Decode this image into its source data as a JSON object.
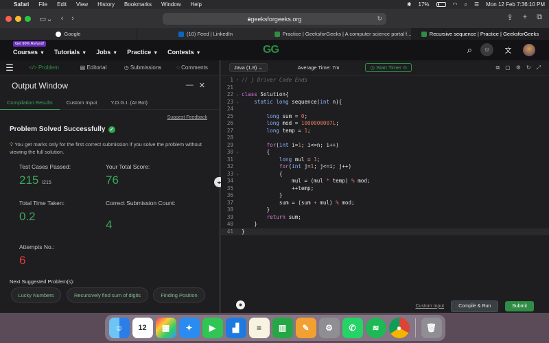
{
  "menubar": {
    "app": "Safari",
    "items": [
      "File",
      "Edit",
      "View",
      "History",
      "Bookmarks",
      "Window",
      "Help"
    ],
    "battery": "17%",
    "datetime": "Mon 12 Feb  7:36:10 PM"
  },
  "browser": {
    "url": "geeksforgeeks.org",
    "tabs": [
      {
        "label": "Google",
        "favicon_color": "#ffffff"
      },
      {
        "label": "(10) Feed | LinkedIn",
        "favicon_color": "#0a66c2"
      },
      {
        "label": "Practice | GeeksforGeeks | A computer science portal f...",
        "favicon_color": "#2f8d46"
      },
      {
        "label": "Recursive sequence | Practice | GeeksforGeeks",
        "favicon_color": "#2f8d46",
        "active": true
      }
    ]
  },
  "site": {
    "refund_badge": "Get 90% Refund!",
    "nav": [
      "Courses",
      "Tutorials",
      "Jobs",
      "Practice",
      "Contests"
    ],
    "logo": "GG"
  },
  "panel_tabs": [
    "Problem",
    "Editorial",
    "Submissions",
    "Comments"
  ],
  "output": {
    "title": "Output Window",
    "tabs": [
      "Compilation Results",
      "Custom Input",
      "Y.O.G.I. (AI Bot)"
    ],
    "suggest_feedback": "Suggest Feedback",
    "solved_text": "Problem Solved Successfully",
    "note": "You get marks only for the first correct submission if you solve the problem without viewing the full solution.",
    "test_cases_label": "Test Cases Passed:",
    "test_cases_value": "215",
    "test_cases_total": "/215",
    "score_label": "Your Total Score:",
    "score_value": "76",
    "time_label": "Total Time Taken:",
    "time_value": "0.2",
    "correct_label": "Correct Submission Count:",
    "correct_value": "4",
    "attempts_label": "Attempts No.:",
    "attempts_value": "6",
    "next_label": "Next Suggested Problem(s):",
    "suggestions": [
      "Lucky Numbers",
      "Recursively find sum of digits",
      "Finding Position"
    ]
  },
  "editor": {
    "language": "Java (1.8)",
    "avg_time": "Average Time: 7m",
    "start_timer": "Start Timer",
    "custom_input": "Custom Input",
    "compile_run": "Compile & Run",
    "submit": "Submit",
    "lines": [
      {
        "n": "1",
        "fold": "›",
        "html": "<span class=\"cm\">// } Driver Code Ends</span>"
      },
      {
        "n": "21",
        "fold": "",
        "html": ""
      },
      {
        "n": "22",
        "fold": "⌄",
        "html": "<span class=\"kw\">class</span> Solution{"
      },
      {
        "n": "23",
        "fold": "⌄",
        "html": "    <span class=\"ty\">static long</span> sequence(<span class=\"ty\">int</span> n){"
      },
      {
        "n": "24",
        "fold": "",
        "html": ""
      },
      {
        "n": "25",
        "fold": "",
        "html": "        <span class=\"ty\">long</span> sum = <span class=\"num\">0</span>;"
      },
      {
        "n": "26",
        "fold": "",
        "html": "        <span class=\"ty\">long</span> mod = <span class=\"num\">1000000007L</span>;"
      },
      {
        "n": "27",
        "fold": "",
        "html": "        <span class=\"ty\">long</span> temp = <span class=\"num\">1</span>;"
      },
      {
        "n": "28",
        "fold": "",
        "html": ""
      },
      {
        "n": "29",
        "fold": "",
        "html": "        <span class=\"kw\">for</span>(<span class=\"ty\">int</span> i=<span class=\"num\">1</span>; i&lt;=n; i++)"
      },
      {
        "n": "30",
        "fold": "⌄",
        "html": "        {"
      },
      {
        "n": "31",
        "fold": "",
        "html": "            <span class=\"ty\">long</span> mul = <span class=\"num\">1</span>;"
      },
      {
        "n": "32",
        "fold": "",
        "html": "            <span class=\"kw\">for</span>(<span class=\"ty\">int</span> j=<span class=\"num\">1</span>; j&lt;=i; j++)"
      },
      {
        "n": "33",
        "fold": "⌄",
        "html": "            {"
      },
      {
        "n": "34",
        "fold": "",
        "html": "                mul = (mul <span class=\"op\">*</span> temp) <span class=\"op\">%</span> mod;"
      },
      {
        "n": "35",
        "fold": "",
        "html": "                ++temp;"
      },
      {
        "n": "36",
        "fold": "",
        "html": "            }"
      },
      {
        "n": "37",
        "fold": "",
        "html": "            sum = (sum <span class=\"op\">+</span> mul) <span class=\"op\">%</span> mod;"
      },
      {
        "n": "38",
        "fold": "",
        "html": "        }"
      },
      {
        "n": "39",
        "fold": "",
        "html": "        <span class=\"kw\">return</span> sum;"
      },
      {
        "n": "40",
        "fold": "",
        "html": "    }"
      },
      {
        "n": "41",
        "fold": "",
        "html": "}",
        "hl": true
      }
    ]
  },
  "colors": {
    "accent": "#2f8d46",
    "success": "#3ba55c",
    "error": "#e23b3b"
  }
}
